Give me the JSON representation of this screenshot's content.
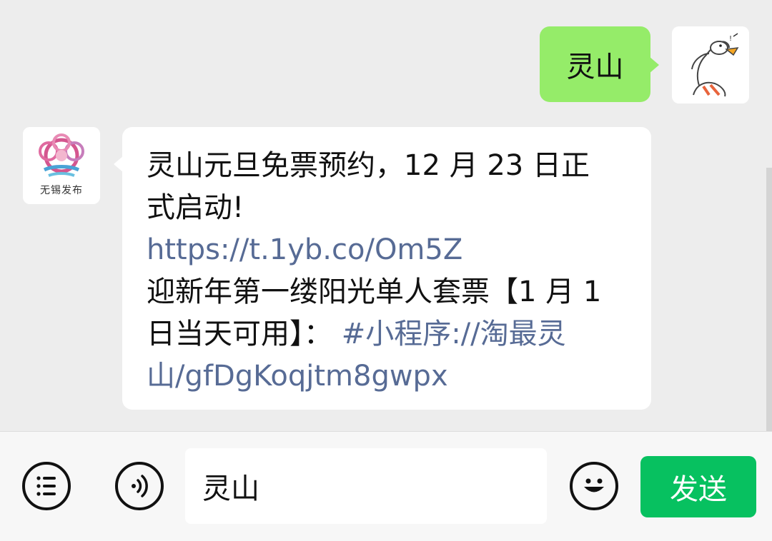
{
  "conversation": {
    "outgoing": {
      "text": "灵山",
      "avatar_icon": "goose-sticker-avatar"
    },
    "incoming": {
      "sender_logo_text": "无锡发布",
      "avatar_icon": "wuxi-release-logo",
      "lines": [
        {
          "text": "灵山元旦免票预约，12 月 23 日正",
          "is_link": false
        },
        {
          "text": "式启动!",
          "is_link": false
        },
        {
          "text": "https://t.1yb.co/Om5Z",
          "is_link": true
        },
        {
          "text": "迎新年第一缕阳光单人套票【1 月 1",
          "is_link": false
        },
        {
          "text": "日当天可用】：",
          "is_link": false,
          "link_suffix": "#小程序://淘最灵"
        },
        {
          "text": "山/gfDgKoqjtm8gwpx",
          "is_link": true
        }
      ]
    }
  },
  "input_bar": {
    "menu_icon": "list-menu-icon",
    "voice_icon": "voice-icon",
    "input_value": "灵山",
    "emoji_icon": "emoji-smile-icon",
    "send_label": "发送"
  },
  "colors": {
    "chat_background": "#ededed",
    "outgoing_bubble": "#95ec69",
    "incoming_bubble": "#ffffff",
    "link": "#576b95",
    "send_button": "#07c160"
  }
}
